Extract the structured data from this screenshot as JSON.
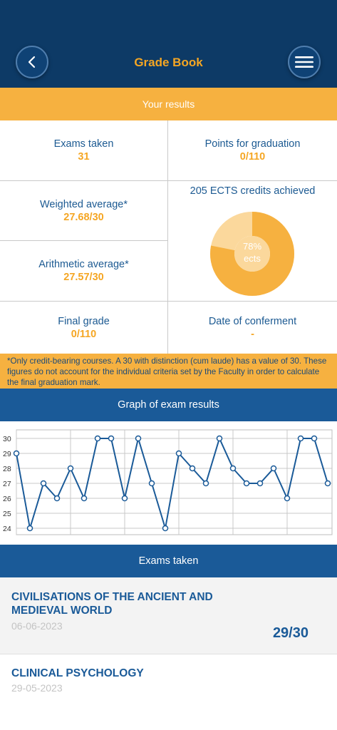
{
  "header": {
    "title": "Grade Book",
    "back_icon": "chevron-left-icon",
    "menu_icon": "hamburger-menu-icon",
    "bg_color": "#0d3a66",
    "title_color": "#f5a623"
  },
  "results": {
    "banner": "Your results",
    "exams_taken": {
      "label": "Exams taken",
      "value": "31"
    },
    "points": {
      "label": "Points for graduation",
      "value": "0/110"
    },
    "weighted": {
      "label": "Weighted average*",
      "value": "27.68/30"
    },
    "arithmetic": {
      "label": "Arithmetic average*",
      "value": "27.57/30"
    },
    "ects": {
      "label": "205 ECTS credits achieved",
      "percent_text": "78%",
      "unit": "ects",
      "fraction": 0.78
    },
    "final_grade": {
      "label": "Final grade",
      "value": "0/110"
    },
    "conferment": {
      "label": "Date of conferment",
      "value": "-"
    }
  },
  "note": "*Only credit-bearing courses. A 30 with distinction (cum laude) has a value of 30. These figures do not account for the individual criteria set by the Faculty in order to calculate the final graduation mark.",
  "graph": {
    "title": "Graph of exam results"
  },
  "chart_data": {
    "type": "line",
    "title": "Graph of exam results",
    "ylim": [
      24,
      30
    ],
    "yticks": [
      "24",
      "25",
      "26",
      "27",
      "28",
      "29",
      "30"
    ],
    "series": [
      {
        "values": [
          29,
          24,
          27,
          26,
          28,
          26,
          30,
          30,
          26,
          30,
          27,
          24,
          29,
          28,
          27,
          30,
          28,
          27,
          27,
          28,
          26,
          30,
          30,
          27
        ]
      }
    ],
    "grid": true,
    "line_color": "#1a5a98"
  },
  "exams": {
    "title": "Exams taken",
    "items": [
      {
        "name": "CIVILISATIONS OF THE ANCIENT AND MEDIEVAL WORLD",
        "date": "06-06-2023",
        "grade": "29/30"
      },
      {
        "name": "CLINICAL PSYCHOLOGY",
        "date": "29-05-2023",
        "grade": ""
      }
    ]
  },
  "colors": {
    "accent_yellow": "#f6b140",
    "brand_blue": "#1a5a98",
    "label_blue": "#1c5a92",
    "value_orange": "#f5a623"
  }
}
